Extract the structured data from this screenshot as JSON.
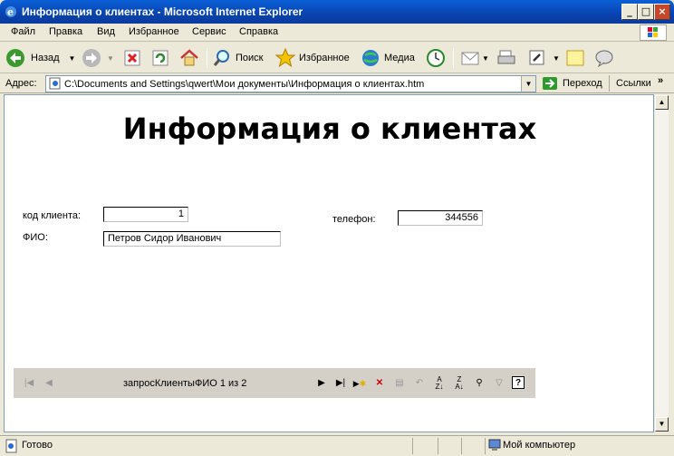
{
  "window": {
    "title": "Информация о клиентах - Microsoft Internet Explorer"
  },
  "menu": [
    "Файл",
    "Правка",
    "Вид",
    "Избранное",
    "Сервис",
    "Справка"
  ],
  "toolbar": {
    "back": "Назад",
    "search": "Поиск",
    "favorites": "Избранное",
    "media": "Медиа"
  },
  "address": {
    "label": "Адрес:",
    "value": "C:\\Documents and Settings\\qwert\\Мои документы\\Информация о клиентах.htm",
    "go": "Переход",
    "links": "Ссылки"
  },
  "page": {
    "title": "Информация о клиентах",
    "client_code_label": "код клиента:",
    "client_code_value": "1",
    "fio_label": "ФИО:",
    "fio_value": "Петров  Сидор  Иванович",
    "phone_label": "телефон:",
    "phone_value": "344556"
  },
  "navigator": {
    "record_text": "запросКлиентыФИО 1 из 2"
  },
  "status": {
    "text": "Готово",
    "zone": "Мой компьютер"
  }
}
